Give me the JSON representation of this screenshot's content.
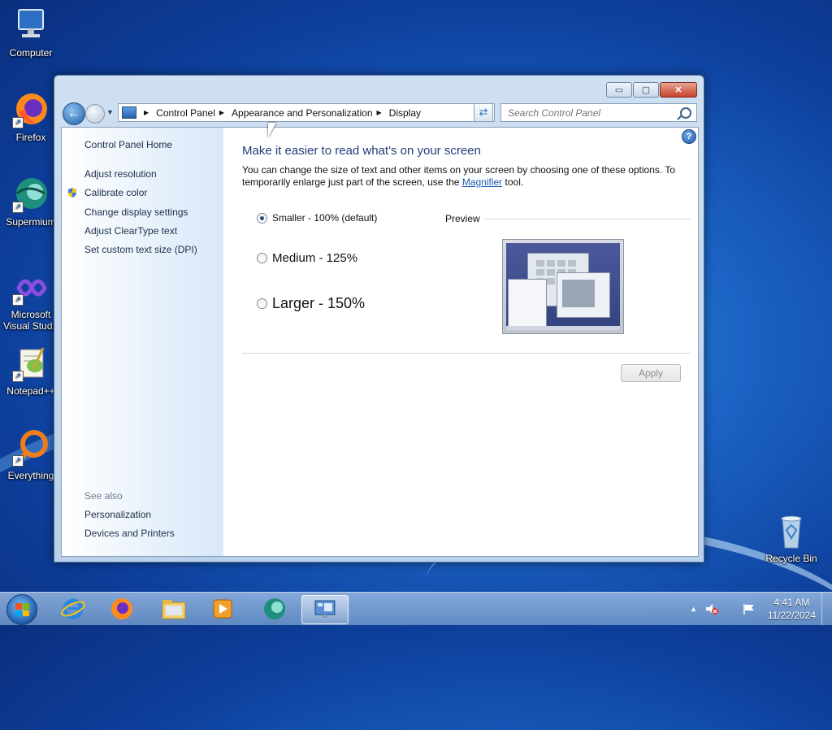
{
  "desktop": {
    "icons": [
      {
        "label": "Computer"
      },
      {
        "label": "Firefox"
      },
      {
        "label": "Supermium"
      },
      {
        "label_line1": "Microsoft",
        "label_line2": "Visual Stud..."
      },
      {
        "label": "Notepad++"
      },
      {
        "label": "Everything"
      },
      {
        "label": "Recycle Bin"
      }
    ]
  },
  "window": {
    "controls": {
      "minimize": "▭",
      "maximize": "▢",
      "close": "✕"
    },
    "address": {
      "segments": [
        "Control Panel",
        "Appearance and Personalization",
        "Display"
      ]
    },
    "search": {
      "placeholder": "Search Control Panel"
    },
    "sidebar": {
      "home": "Control Panel Home",
      "links": [
        "Adjust resolution",
        "Calibrate color",
        "Change display settings",
        "Adjust ClearType text",
        "Set custom text size (DPI)"
      ],
      "see_also": "See also",
      "see_also_links": [
        "Personalization",
        "Devices and Printers"
      ]
    },
    "main": {
      "heading": "Make it easier to read what's on your screen",
      "desc_before": "You can change the size of text and other items on your screen by choosing one of these options. To temporarily enlarge just part of the screen, use the ",
      "desc_link": "Magnifier",
      "desc_after": " tool.",
      "options": [
        {
          "label": "Smaller - 100% (default)",
          "selected": true
        },
        {
          "label": "Medium - 125%",
          "selected": false
        },
        {
          "label": "Larger - 150%",
          "selected": false
        }
      ],
      "preview_label": "Preview",
      "apply_label": "Apply",
      "help": "?"
    }
  },
  "taskbar": {
    "clock_time": "4:41 AM",
    "clock_date": "11/22/2024",
    "tray_chevron": "▲"
  },
  "colors": {
    "heading": "#1f3d7a",
    "link": "#1c5bb0",
    "accent": "#1d5fa8"
  }
}
